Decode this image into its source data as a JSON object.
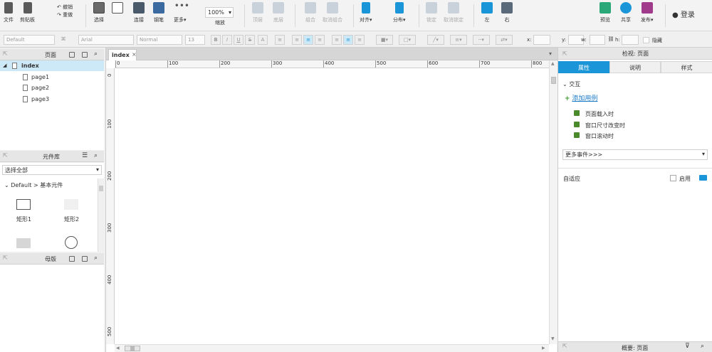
{
  "toolbar": {
    "file": "文件",
    "clipboard": "剪贴板",
    "undo": "撤销",
    "redo": "重做",
    "select": "选择",
    "connect": "连接",
    "pen": "钢笔",
    "more": "更多▾",
    "zoom_value": "100%",
    "zoom_label": "缩放",
    "top": "顶层",
    "bottom": "底层",
    "group": "组合",
    "ungroup": "取消组合",
    "align": "对齐▾",
    "distribute": "分布▾",
    "lock": "锁定",
    "unlock": "取消锁定",
    "left": "左",
    "right": "右",
    "preview": "预览",
    "share": "共享",
    "publish": "发布▾",
    "login": "登录"
  },
  "format": {
    "style": "Default",
    "font": "Arial",
    "weight": "Normal",
    "size": "13",
    "bold": "B",
    "italic": "I",
    "underline": "U",
    "strike": "S",
    "x_label": "x:",
    "y_label": "y:",
    "w_label": "w:",
    "h_label": "h:",
    "hidden": "隐藏"
  },
  "pages_panel": {
    "title": "页面",
    "root": "index",
    "children": [
      "page1",
      "page2",
      "page3"
    ]
  },
  "library_panel": {
    "title": "元件库",
    "select_value": "选择全部",
    "group": "Default > 基本元件",
    "items": [
      "矩形1",
      "矩形2"
    ]
  },
  "masters_panel": {
    "title": "母版"
  },
  "canvas": {
    "tab": "index",
    "tab_close": "×",
    "ruler_h": [
      "0",
      "100",
      "200",
      "300",
      "400",
      "500",
      "600",
      "700",
      "800"
    ],
    "ruler_v": [
      "0",
      "100",
      "200",
      "300",
      "400",
      "500"
    ],
    "scroll_grip": "|||"
  },
  "inspector": {
    "title": "检视: 页面",
    "tabs": [
      "属性",
      "说明",
      "样式"
    ],
    "interaction": "交互",
    "add_case": "添加用例",
    "events": [
      "页面载入时",
      "窗口尺寸改变时",
      "窗口滚动时"
    ],
    "more_events": "更多事件>>>",
    "adaptive": "自适应",
    "enable": "启用",
    "overview": "概要: 页面"
  },
  "colors": {
    "accent": "#1a96d8",
    "selected_row": "#cde8f6"
  }
}
